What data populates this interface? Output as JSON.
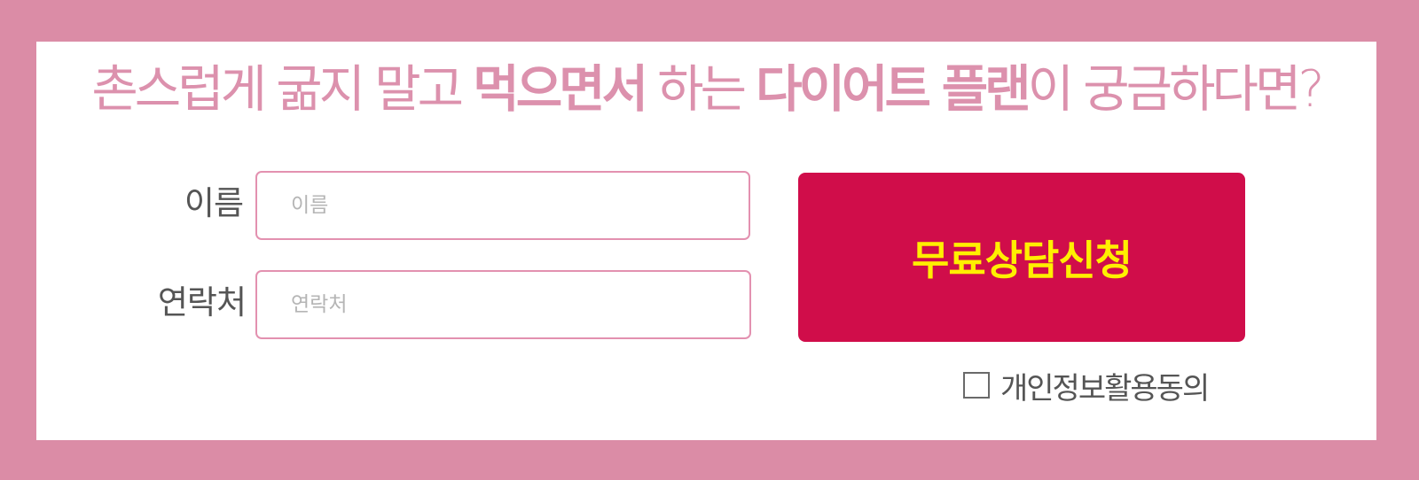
{
  "headline": {
    "part1": "촌스럽게 굶지 말고 ",
    "part2": "먹으면서",
    "part3": " 하는 ",
    "part4": "다이어트 플랜",
    "part5": "이 궁금하다면?"
  },
  "form": {
    "name_label": "이름",
    "name_placeholder": "이름",
    "name_value": "",
    "phone_label": "연락처",
    "phone_placeholder": "연락처",
    "phone_value": "",
    "submit_label": "무료상담신청",
    "consent_label": "개인정보활용동의",
    "consent_checked": false
  },
  "colors": {
    "frame": "#db8ca6",
    "headline": "#dc91ad",
    "button": "#d00d4a",
    "button_text": "#ffef00",
    "input_border": "#e391b0"
  }
}
